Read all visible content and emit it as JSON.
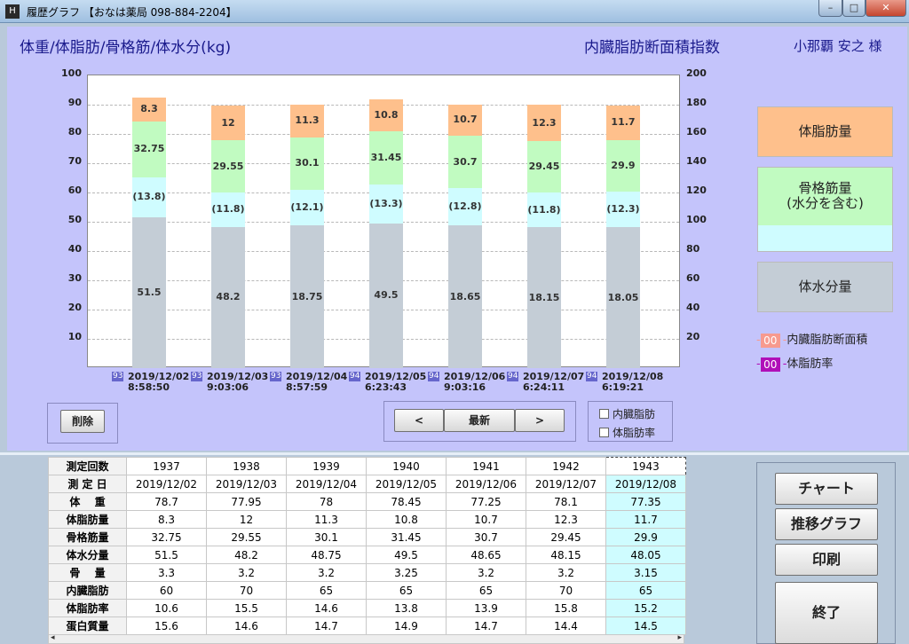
{
  "window": {
    "title": "履歴グラフ 【おなは薬局 098-884-2204】",
    "min_glyph": "–",
    "max_glyph": "□",
    "close_glyph": "✕",
    "app_glyph": "H"
  },
  "header": {
    "chart_title": "体重/体脂肪/骨格筋/体水分(kg)",
    "visceral_title": "内臓脂肪断面積指数",
    "patient": "小那覇 安之 様"
  },
  "chart_data": {
    "type": "bar",
    "stacked": true,
    "categories": [
      "2019/12/02 8:58:50",
      "2019/12/03 9:03:06",
      "2019/12/04 8:57:59",
      "2019/12/05 6:23:43",
      "2019/12/06 9:03:16",
      "2019/12/07 6:24:11",
      "2019/12/08 6:19:21"
    ],
    "dates": [
      "2019/12/02",
      "2019/12/03",
      "2019/12/04",
      "2019/12/05",
      "2019/12/06",
      "2019/12/07",
      "2019/12/08"
    ],
    "times": [
      "8:58:50",
      "9:03:06",
      "8:57:59",
      "6:23:43",
      "9:03:16",
      "6:24:11",
      "6:19:21"
    ],
    "index_labels": [
      "93",
      "93",
      "93",
      "94",
      "94",
      "94",
      "94"
    ],
    "series": [
      {
        "name": "体水分量",
        "values": [
          51.5,
          48.2,
          48.75,
          49.5,
          48.65,
          48.15,
          48.05
        ],
        "labels": [
          "51.5",
          "48.2",
          "18.75",
          "49.5",
          "18.65",
          "18.15",
          "18.05"
        ],
        "color": "#c4cdd6"
      },
      {
        "name": "骨格筋量(水分を含む)",
        "values": [
          32.75,
          29.55,
          30.1,
          31.45,
          30.7,
          29.45,
          29.9
        ],
        "labels": [
          "32.75",
          "29.55",
          "30.1",
          "31.45",
          "30.7",
          "29.45",
          "29.9"
        ],
        "color": "#c1fbc1",
        "inner_water": [
          13.8,
          11.8,
          12.1,
          13.3,
          12.8,
          11.8,
          12.3
        ],
        "inner_water_labels": [
          "(13.8)",
          "(11.8)",
          "(12.1)",
          "(13.3)",
          "(12.8)",
          "(11.8)",
          "(12.3)"
        ],
        "inner_color": "#cffcff"
      },
      {
        "name": "体脂肪量",
        "values": [
          8.3,
          12,
          11.3,
          10.8,
          10.7,
          12.3,
          11.7
        ],
        "labels": [
          "8.3",
          "12",
          "11.3",
          "10.8",
          "10.7",
          "12.3",
          "11.7"
        ],
        "color": "#fec08c"
      }
    ],
    "y_left": {
      "min": 0,
      "max": 100,
      "ticks": [
        10,
        20,
        30,
        40,
        50,
        60,
        70,
        80,
        90,
        100
      ]
    },
    "y_right": {
      "min": 0,
      "max": 200,
      "ticks": [
        20,
        40,
        60,
        80,
        100,
        120,
        140,
        160,
        180,
        200
      ]
    },
    "grid": true,
    "legend_placement": "right"
  },
  "legend": {
    "fat": "体脂肪量",
    "muscle_line1": "骨格筋量",
    "muscle_line2": "(水分を含む)",
    "water": "体水分量",
    "visceral_mark": "00",
    "visceral_label": "内臓脂肪断面積",
    "bodyfat_mark": "00",
    "bodyfat_label": "体脂肪率",
    "colors": {
      "visceral": "#f79a8f",
      "bodyfat": "#b00fb8"
    }
  },
  "controls": {
    "delete": "削除",
    "prev": "<",
    "latest": "最新",
    "next": ">",
    "chk_visceral": "内臓脂肪",
    "chk_bodyfat": "体脂肪率"
  },
  "table": {
    "header": {
      "label": "測定回数",
      "values": [
        "1937",
        "1938",
        "1939",
        "1940",
        "1941",
        "1942",
        "1943"
      ]
    },
    "rows": [
      {
        "label": "測 定 日",
        "values": [
          "2019/12/02",
          "2019/12/03",
          "2019/12/04",
          "2019/12/05",
          "2019/12/06",
          "2019/12/07",
          "2019/12/08"
        ]
      },
      {
        "label": "体　 重",
        "values": [
          "78.7",
          "77.95",
          "78",
          "78.45",
          "77.25",
          "78.1",
          "77.35"
        ]
      },
      {
        "label": "体脂肪量",
        "values": [
          "8.3",
          "12",
          "11.3",
          "10.8",
          "10.7",
          "12.3",
          "11.7"
        ]
      },
      {
        "label": "骨格筋量",
        "values": [
          "32.75",
          "29.55",
          "30.1",
          "31.45",
          "30.7",
          "29.45",
          "29.9"
        ]
      },
      {
        "label": "体水分量",
        "values": [
          "51.5",
          "48.2",
          "48.75",
          "49.5",
          "48.65",
          "48.15",
          "48.05"
        ]
      },
      {
        "label": "骨　 量",
        "values": [
          "3.3",
          "3.2",
          "3.2",
          "3.25",
          "3.2",
          "3.2",
          "3.15"
        ]
      },
      {
        "label": "内臓脂肪",
        "values": [
          "60",
          "70",
          "65",
          "65",
          "65",
          "70",
          "65"
        ]
      },
      {
        "label": "体脂肪率",
        "values": [
          "10.6",
          "15.5",
          "14.6",
          "13.8",
          "13.9",
          "15.8",
          "15.2"
        ]
      },
      {
        "label": "蛋白質量",
        "values": [
          "15.6",
          "14.6",
          "14.7",
          "14.9",
          "14.7",
          "14.4",
          "14.5"
        ]
      }
    ],
    "scroll_left": "◂",
    "scroll_right": "▸"
  },
  "side_buttons": {
    "chart": "チャート",
    "trend": "推移グラフ",
    "print": "印刷",
    "exit": "終了"
  }
}
